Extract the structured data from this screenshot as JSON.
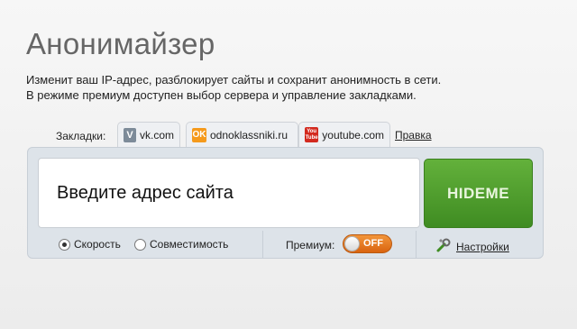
{
  "header": {
    "title": "Анонимайзер",
    "description_line1": "Изменит ваш IP-адрес, разблокирует сайты и сохранит анонимность в сети.",
    "description_line2": "В режиме премиум доступен выбор сервера и управление закладками."
  },
  "bookmarks": {
    "label": "Закладки:",
    "items": [
      {
        "label": "vk.com",
        "icon": "vk-icon",
        "glyph": "V"
      },
      {
        "label": "odnoklassniki.ru",
        "icon": "odnoklassniki-icon",
        "glyph": "OK"
      },
      {
        "label": "youtube.com",
        "icon": "youtube-icon",
        "glyph_top": "You",
        "glyph_bottom": "Tube"
      }
    ],
    "edit_label": "Правка"
  },
  "form": {
    "url_placeholder": "Введите адрес сайта",
    "submit_label": "HIDEME"
  },
  "options": {
    "speed_label": "Скорость",
    "speed_selected": true,
    "compat_label": "Совместимость",
    "compat_selected": false,
    "premium_label": "Премиум:",
    "premium_state": "OFF",
    "settings_label": "Настройки"
  },
  "colors": {
    "go_button": "#4f9e2c",
    "toggle": "#e8761f",
    "panel": "#dde3e9"
  }
}
